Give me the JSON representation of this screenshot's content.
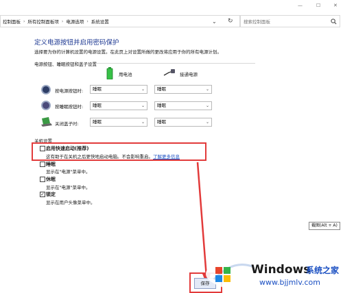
{
  "window": {
    "minimize_glyph": "—",
    "maximize_glyph": "☐",
    "close_glyph": "✕"
  },
  "address_bar": {
    "crumbs": [
      "控制面板",
      "所有控制面板项",
      "电源选项",
      "系统设置"
    ],
    "dropdown_glyph": "⌄",
    "refresh_glyph": "↻",
    "search_placeholder": "搜索控制面板"
  },
  "page": {
    "title": "定义电源按钮并启用密码保护",
    "subtitle": "选择要为你的计算机设置的电源设置。在此页上对设置所做的更改将应用于你的所有电源计划。",
    "group_buttons_title": "电源按钮、睡眠按钮和盖子设置",
    "col_battery": "用电池",
    "col_plugged": "接通电源",
    "rows": [
      {
        "label": "按电源按钮时:",
        "battery": "睡眠",
        "plugged": "睡眠",
        "icon": "power-icon"
      },
      {
        "label": "按睡眠按钮时:",
        "battery": "睡眠",
        "plugged": "睡眠",
        "icon": "sleep-icon"
      },
      {
        "label": "关闭盖子时:",
        "battery": "睡眠",
        "plugged": "睡眠",
        "icon": "lid-icon"
      }
    ],
    "group_shutdown_title": "关机设置",
    "options": [
      {
        "title": "启用快速启动(推荐)",
        "desc": "这有助于在关机之后更快地启动电脑。不会影响重启。",
        "link": "了解更多信息",
        "checked": false
      },
      {
        "title": "睡眠",
        "desc": "显示在\"电源\"菜单中。",
        "checked": false
      },
      {
        "title": "休眠",
        "desc": "显示在\"电源\"菜单中。",
        "checked": false
      },
      {
        "title": "锁定",
        "desc": "显示在用户头像菜单中。",
        "checked": true
      }
    ],
    "save_label": "保存"
  },
  "tooltip": {
    "text": "截图(Alt + A)"
  },
  "watermark": {
    "brand": "Windows",
    "tagline": "系统之家",
    "url": "www.bjjmlv.com"
  },
  "colors": {
    "title_blue": "#1f3a93",
    "highlight_red": "#e23a3a",
    "link_blue": "#1a4fc2"
  }
}
